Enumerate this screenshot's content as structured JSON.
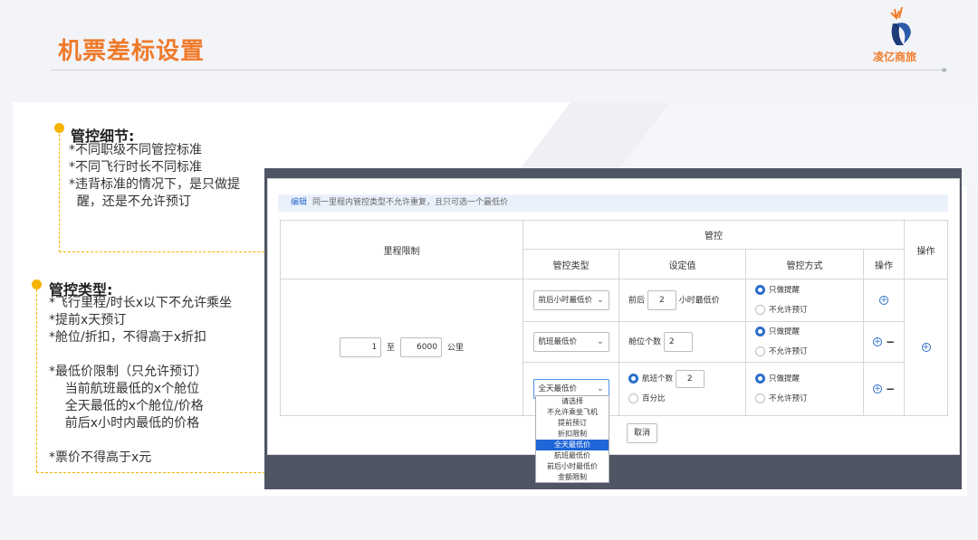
{
  "slide": {
    "title": "机票差标设置"
  },
  "logo": {
    "text": "凌亿商旅"
  },
  "notes": {
    "detail": {
      "title": "管控细节:",
      "lines": [
        "*不同职级不同管控标准",
        "*不同飞行时长不同标准",
        "*违背标准的情况下，是只做提",
        "  醒，还是不允许预订"
      ]
    },
    "type": {
      "title": "管控类型:",
      "lines": [
        "*飞行里程/时长x以下不允许乘坐",
        "*提前x天预订",
        "*舱位/折扣，不得高于x折扣",
        "",
        "*最低价限制（只允许预订）",
        "    当前航班最低的x个舱位",
        "    全天最低的x个舱位/价格",
        "    前后x小时内最低的价格",
        "",
        "*票价不得高于x元"
      ]
    }
  },
  "screen": {
    "hint_edit": "编辑",
    "hint_text": "同一里程内管控类型不允许重复，且只可选一个最低价",
    "headers": {
      "mileage": "里程限制",
      "control": "管控",
      "action_outer": "操作",
      "control_type": "管控类型",
      "set_value": "设定值",
      "control_mode": "管控方式",
      "action_inner": "操作"
    },
    "mileage": {
      "from": "1",
      "sep": "至",
      "to": "6000",
      "unit": "公里"
    },
    "rows": [
      {
        "type": "前后小时最低价",
        "value_prefix": "前后",
        "value": "2",
        "value_suffix": "小时最低价",
        "mode_on": "只做提醒",
        "mode_off": "不允许预订"
      },
      {
        "type": "航班最低价",
        "value_prefix": "舱位个数",
        "value": "2",
        "mode_on": "只做提醒",
        "mode_off": "不允许预订"
      },
      {
        "type": "全天最低价",
        "radio_a": "航班个数",
        "value": "2",
        "radio_b": "百分比",
        "mode_on": "只做提醒",
        "mode_off": "不允许预订"
      }
    ],
    "dropdown": {
      "options": [
        "请选择",
        "不允许乘坐飞机",
        "提前预订",
        "折扣限制",
        "全天最低价",
        "航班最低价",
        "前后小时最低价",
        "金额限制"
      ],
      "selected_index": 4
    },
    "cancel_label": "取消"
  },
  "colors": {
    "accent": "#ef7a2a",
    "note_dot": "#f5b400",
    "link": "#2c6ecb",
    "highlight": "#1f66d8"
  }
}
